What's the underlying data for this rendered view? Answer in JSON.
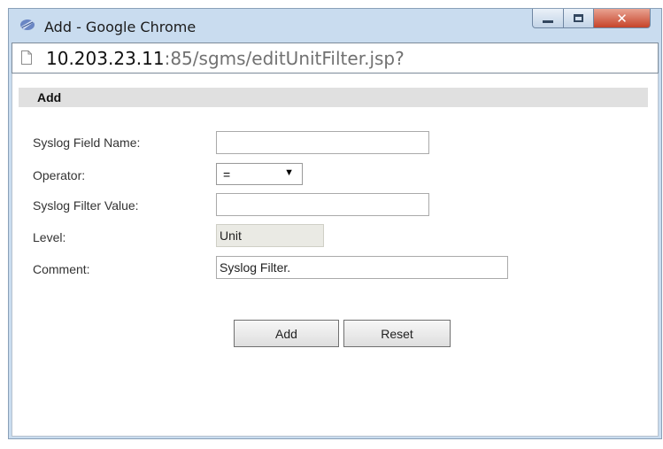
{
  "window": {
    "title": "Add - Google Chrome"
  },
  "address_bar": {
    "host": "10.203.23.11",
    "rest": ":85/sgms/editUnitFilter.jsp?"
  },
  "form": {
    "section_title": "Add",
    "syslog_field_name": {
      "label": "Syslog Field Name:",
      "value": ""
    },
    "operator": {
      "label": "Operator:",
      "value": "="
    },
    "syslog_filter_value": {
      "label": "Syslog Filter Value:",
      "value": ""
    },
    "level": {
      "label": "Level:",
      "value": "Unit"
    },
    "comment": {
      "label": "Comment:",
      "value": "Syslog Filter."
    },
    "add_label": "Add",
    "reset_label": "Reset"
  },
  "colors": {
    "window_frame": "#c9dcef",
    "close_button": "#c6442a",
    "section_header": "#e0e0e0",
    "readonly_field": "#eaeae4"
  },
  "icons": [
    "chrome-icon",
    "minimize-icon",
    "maximize-icon",
    "close-icon",
    "page-icon",
    "dropdown-arrow-icon"
  ]
}
